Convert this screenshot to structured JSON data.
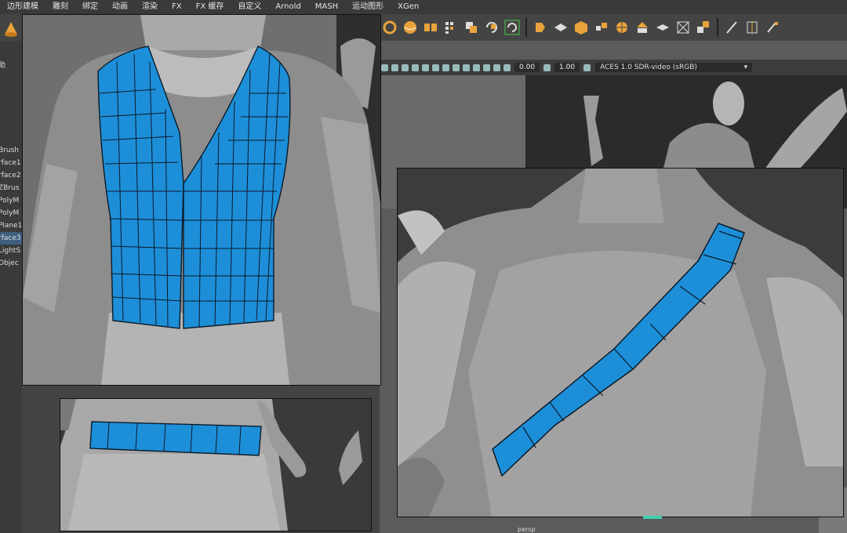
{
  "menubar": {
    "items": [
      "边形建模",
      "雕刻",
      "绑定",
      "动画",
      "渲染",
      "FX",
      "FX 缓存",
      "自定义",
      "Arnold",
      "MASH",
      "运动图形",
      "XGen"
    ]
  },
  "outliner": {
    "header": "助",
    "items": [
      "Brush",
      "rface1",
      "rface2",
      "ZBrus",
      "PolyM",
      "PolyM",
      "Plane1",
      "rface3",
      "LightS",
      "Objec"
    ],
    "selected_index": 7
  },
  "viewport_bar": {
    "value1": "0.00",
    "value2": "1.00",
    "color_space": "ACES 1.0 SDR-video (sRGB)"
  },
  "camera_label": "persp",
  "colors": {
    "accent_orange": "#e8a33b",
    "mesh_blue": "#1d8fd8",
    "selection": "#3f5f7f"
  }
}
